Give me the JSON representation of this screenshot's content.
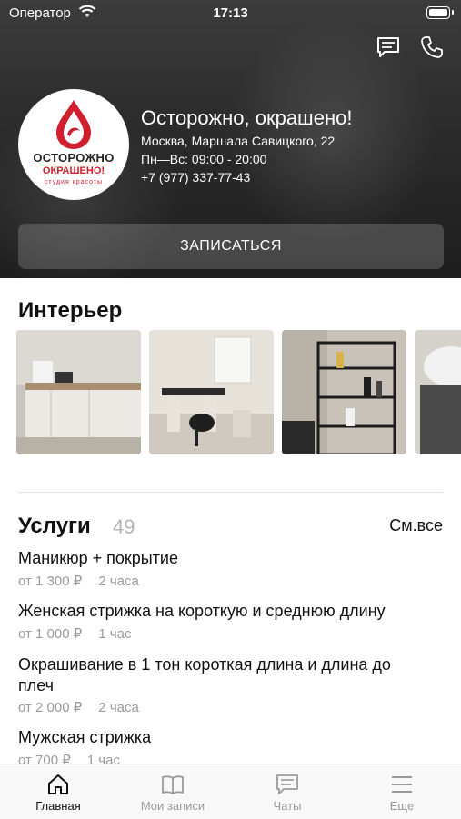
{
  "status_bar": {
    "carrier": "Оператор",
    "time": "17:13"
  },
  "salon": {
    "name": "Осторожно, окрашено!",
    "address": "Москва, Маршала Савицкого, 22",
    "hours": "Пн—Вс: 09:00 - 20:00",
    "phone": "+7 (977) 337-77-43",
    "logo": {
      "line1": "ОСТОРОЖНО",
      "line2": "ОКРАШЕНО!",
      "line3": "студия красоты"
    }
  },
  "book_button": "ЗАПИСАТЬСЯ",
  "interior": {
    "title": "Интерьер"
  },
  "services": {
    "title": "Услуги",
    "count": "49",
    "see_all": "См.все",
    "items": [
      {
        "name": "Маникюр + покрытие",
        "price": "от 1 300 ₽",
        "duration": "2 часа"
      },
      {
        "name": "Женская стрижка на короткую и среднюю длину",
        "price": "от 1 000 ₽",
        "duration": "1 час"
      },
      {
        "name": "Окрашивание в 1 тон короткая длина и длина до плеч",
        "price": "от 2 000 ₽",
        "duration": "2 часа"
      },
      {
        "name": "Мужская стрижка",
        "price": "от 700 ₽",
        "duration": "1 час"
      }
    ]
  },
  "tabs": [
    {
      "label": "Главная",
      "icon": "home-icon",
      "active": true
    },
    {
      "label": "Мои записи",
      "icon": "book-icon",
      "active": false
    },
    {
      "label": "Чаты",
      "icon": "chat-icon",
      "active": false
    },
    {
      "label": "Еще",
      "icon": "menu-icon",
      "active": false
    }
  ],
  "colors": {
    "active_tab": "#111111",
    "inactive_tab": "#9a9a9a",
    "brand_red": "#d02030"
  }
}
